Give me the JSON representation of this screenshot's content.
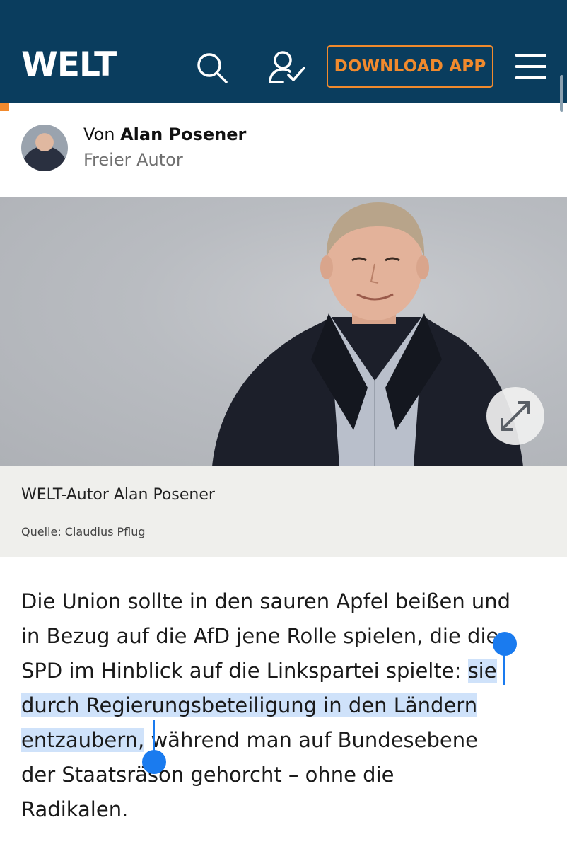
{
  "header": {
    "logo": "WELT",
    "download_label": "DOWNLOAD APP",
    "icons": [
      "search-icon",
      "user-check-icon",
      "menu-icon"
    ],
    "background": "#0a3d5e",
    "accent": "#f18a2d"
  },
  "author": {
    "prefix": "Von",
    "name": "Alan Posener",
    "role": "Freier Autor"
  },
  "image": {
    "caption": "WELT-Autor Alan Posener",
    "source": "Quelle: Claudius Pflug"
  },
  "article": {
    "line1": "Die Union sollte in den sauren Apfel beißen und",
    "line2": "in Bezug auf die AfD jene Rolle spielen, die die",
    "line3_plain": "SPD im Hinblick auf die Linkspartei spielte: ",
    "line3_sel": "sie",
    "line4_sel": "durch Regierungsbeteiligung in den Ländern",
    "line5_sel": "entzaubern,",
    "line5_plain": " während man auf Bundesebene",
    "line6": "der Staatsräson gehorcht – ohne die",
    "line7": "Radikalen."
  },
  "selection_color": "#cfe2fa",
  "handle_color": "#1a7bef"
}
